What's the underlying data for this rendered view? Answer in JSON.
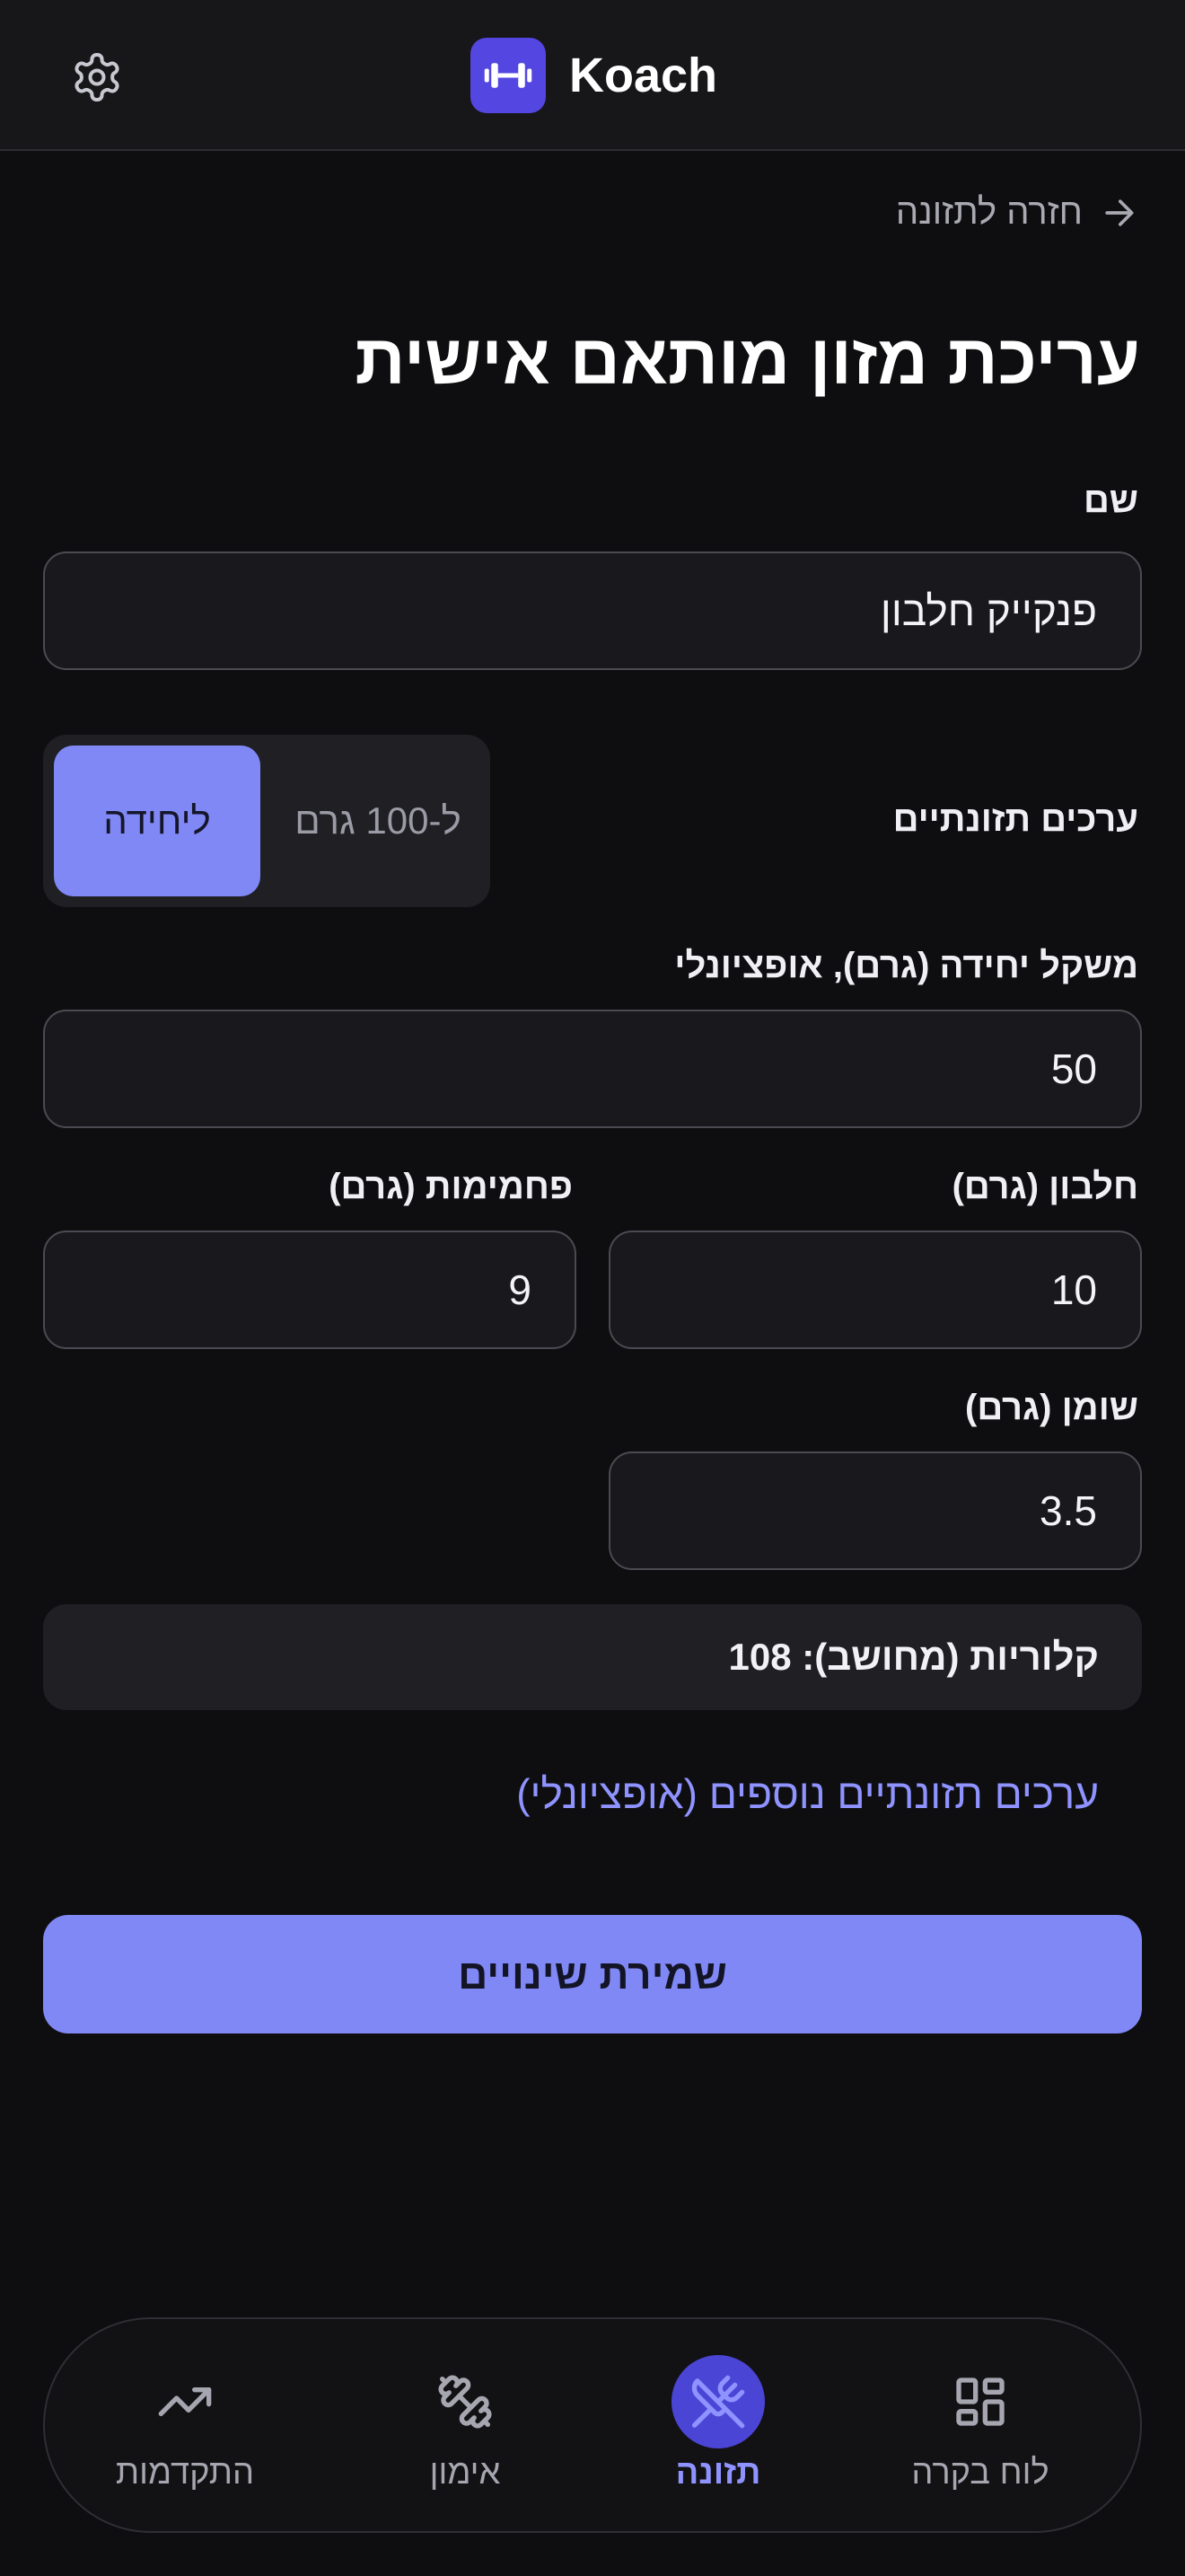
{
  "header": {
    "app_name": "Koach",
    "settings_icon": "gear-icon",
    "logo_icon": "dumbbell-icon"
  },
  "back_link": {
    "label": "חזרה לתזונה",
    "icon": "arrow-right-icon"
  },
  "page_title": "עריכת מזון מותאם אישית",
  "form": {
    "name_label": "שם",
    "name_value": "פנקייק חלבון",
    "nutrition_values_label": "ערכים תזונתיים",
    "basis_toggle": {
      "options": [
        "ליחידה",
        "ל-100 גרם"
      ],
      "selected": "ליחידה"
    },
    "unit_weight_label": "משקל יחידה (גרם), אופציונלי",
    "unit_weight_value": "50",
    "protein_label": "חלבון (גרם)",
    "protein_value": "10",
    "carbs_label": "פחמימות (גרם)",
    "carbs_value": "9",
    "fat_label": "שומן (גרם)",
    "fat_value": "3.5",
    "calories_text": "קלוריות (מחושב): 108",
    "more_nutrition_link": "ערכים תזונתיים נוספים (אופציונלי)",
    "save_button": "שמירת שינויים"
  },
  "bottom_nav": {
    "items": [
      {
        "label": "התקדמות",
        "icon": "trending-up-icon",
        "active": false
      },
      {
        "label": "אימון",
        "icon": "dumbbell-icon",
        "active": false
      },
      {
        "label": "תזונה",
        "icon": "fork-knife-icon",
        "active": true
      },
      {
        "label": "לוח בקרה",
        "icon": "grid-icon",
        "active": false
      }
    ]
  },
  "colors": {
    "accent": "#8088f5",
    "brand": "#5446e0",
    "background": "#0e0e10",
    "link": "#8f93ff"
  }
}
